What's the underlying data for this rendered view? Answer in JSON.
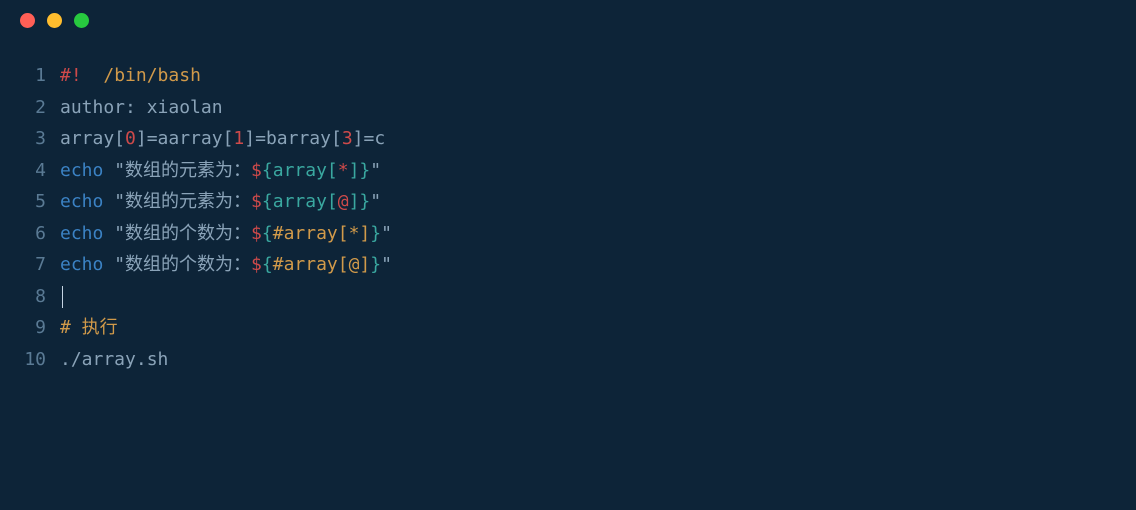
{
  "titlebar": {
    "trafficLights": [
      "red",
      "yellow",
      "green"
    ]
  },
  "code": {
    "lines": [
      {
        "num": "1",
        "tokens": [
          {
            "text": "#!",
            "cls": "c-red"
          },
          {
            "text": "  ",
            "cls": "c-orange"
          },
          {
            "text": "/bin/bash",
            "cls": "c-orange"
          }
        ]
      },
      {
        "num": "2",
        "tokens": [
          {
            "text": "author: xiaolan",
            "cls": "c-gray"
          }
        ]
      },
      {
        "num": "3",
        "tokens": [
          {
            "text": "array[",
            "cls": "c-gray"
          },
          {
            "text": "0",
            "cls": "c-red"
          },
          {
            "text": "]=aarray[",
            "cls": "c-gray"
          },
          {
            "text": "1",
            "cls": "c-red"
          },
          {
            "text": "]=barray[",
            "cls": "c-gray"
          },
          {
            "text": "3",
            "cls": "c-red"
          },
          {
            "text": "]=c",
            "cls": "c-gray"
          }
        ]
      },
      {
        "num": "4",
        "tokens": [
          {
            "text": "echo",
            "cls": "c-blue"
          },
          {
            "text": " \"数组的元素为：",
            "cls": "c-gray"
          },
          {
            "text": "$",
            "cls": "c-red"
          },
          {
            "text": "{array[",
            "cls": "c-teal"
          },
          {
            "text": "*",
            "cls": "c-red"
          },
          {
            "text": "]}",
            "cls": "c-teal"
          },
          {
            "text": "\"",
            "cls": "c-gray"
          }
        ]
      },
      {
        "num": "5",
        "tokens": [
          {
            "text": "echo",
            "cls": "c-blue"
          },
          {
            "text": " \"数组的元素为：",
            "cls": "c-gray"
          },
          {
            "text": "$",
            "cls": "c-red"
          },
          {
            "text": "{array[",
            "cls": "c-teal"
          },
          {
            "text": "@",
            "cls": "c-red"
          },
          {
            "text": "]}",
            "cls": "c-teal"
          },
          {
            "text": "\"",
            "cls": "c-gray"
          }
        ]
      },
      {
        "num": "6",
        "tokens": [
          {
            "text": "echo",
            "cls": "c-blue"
          },
          {
            "text": " \"数组的个数为：",
            "cls": "c-gray"
          },
          {
            "text": "$",
            "cls": "c-red"
          },
          {
            "text": "{",
            "cls": "c-teal"
          },
          {
            "text": "#array[*]",
            "cls": "c-orange"
          },
          {
            "text": "}",
            "cls": "c-teal"
          },
          {
            "text": "\"",
            "cls": "c-gray"
          }
        ]
      },
      {
        "num": "7",
        "tokens": [
          {
            "text": "echo",
            "cls": "c-blue"
          },
          {
            "text": " \"数组的个数为：",
            "cls": "c-gray"
          },
          {
            "text": "$",
            "cls": "c-red"
          },
          {
            "text": "{",
            "cls": "c-teal"
          },
          {
            "text": "#array[@]",
            "cls": "c-orange"
          },
          {
            "text": "}",
            "cls": "c-teal"
          },
          {
            "text": "\"",
            "cls": "c-gray"
          }
        ]
      },
      {
        "num": "8",
        "tokens": [],
        "cursor": true
      },
      {
        "num": "9",
        "tokens": [
          {
            "text": "# 执行",
            "cls": "c-orange"
          }
        ]
      },
      {
        "num": "10",
        "tokens": [
          {
            "text": "./array.sh",
            "cls": "c-gray"
          }
        ]
      }
    ]
  }
}
